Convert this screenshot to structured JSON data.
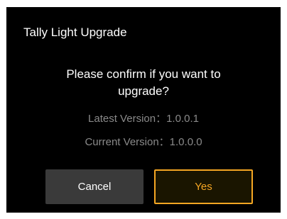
{
  "dialog": {
    "title": "Tally Light Upgrade",
    "message_line1": "Please confirm if you want to",
    "message_line2": "upgrade?",
    "latest_version_label": "Latest Version：",
    "latest_version_value": "1.0.0.1",
    "current_version_label": "Current Version：",
    "current_version_value": "1.0.0.0",
    "cancel_label": "Cancel",
    "yes_label": "Yes"
  },
  "colors": {
    "background": "#000000",
    "accent": "#f5a623",
    "muted_text": "#8a8a8a",
    "cancel_button": "#3a3a3a"
  }
}
